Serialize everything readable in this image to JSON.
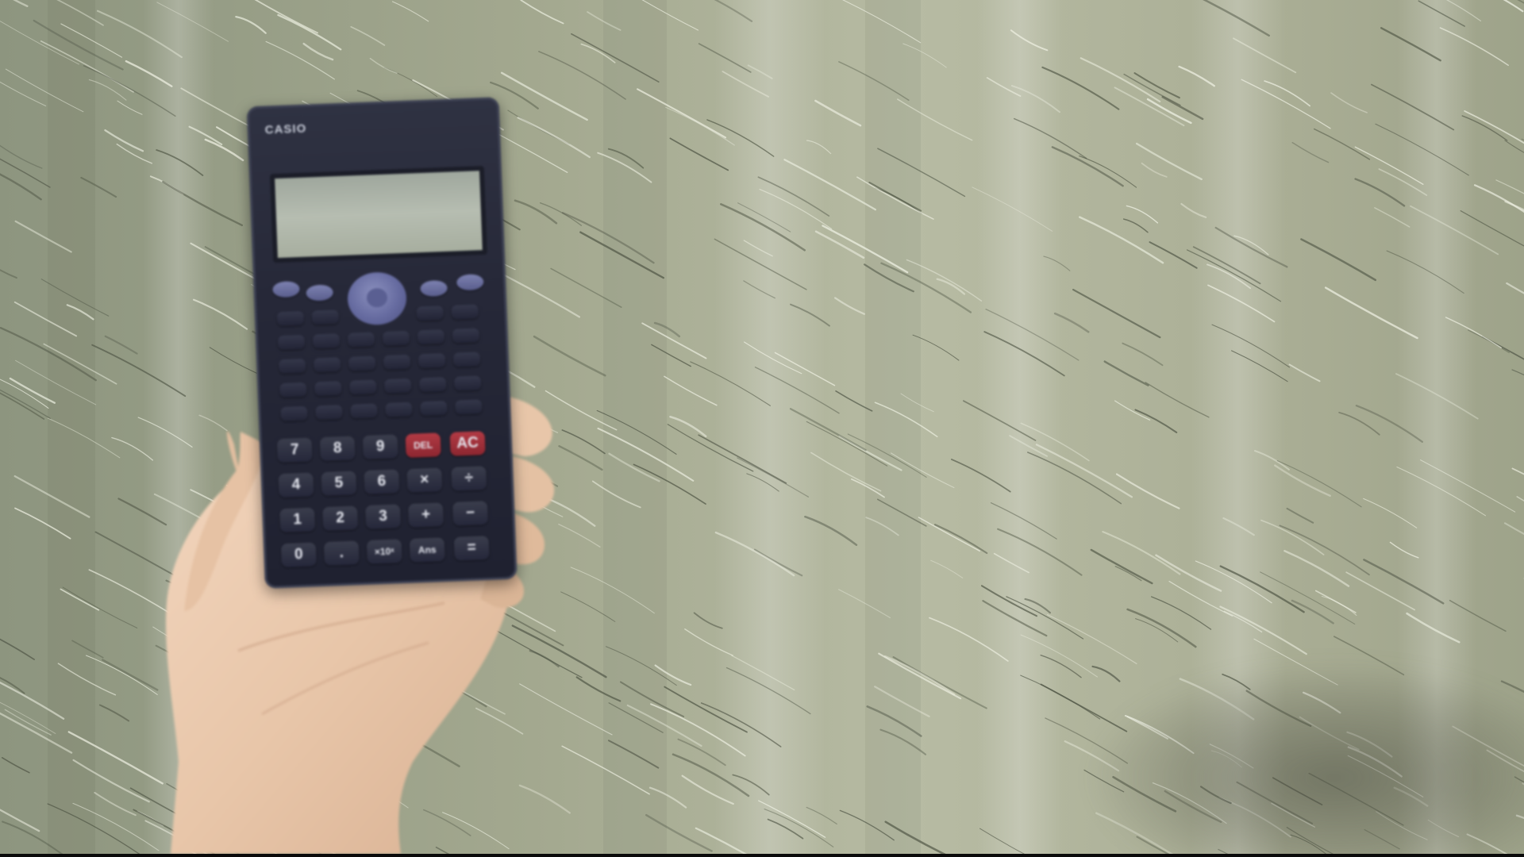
{
  "scene": {
    "description_colors": {
      "fabric": "#a3a88f",
      "calculator_body": "#262838",
      "display_lcd": "#b0b8ab",
      "skin": "#e8c6a9",
      "red_keys": "#9c2e38"
    }
  },
  "calculator": {
    "brand": "CASIO",
    "keys_row1": [
      "7",
      "8",
      "9",
      "DEL",
      "AC"
    ],
    "keys_row2": [
      "4",
      "5",
      "6",
      "×",
      "÷"
    ],
    "keys_row3": [
      "1",
      "2",
      "3",
      "+",
      "−"
    ],
    "keys_row4": [
      "0",
      ".",
      "×10ˣ",
      "Ans",
      "="
    ]
  }
}
